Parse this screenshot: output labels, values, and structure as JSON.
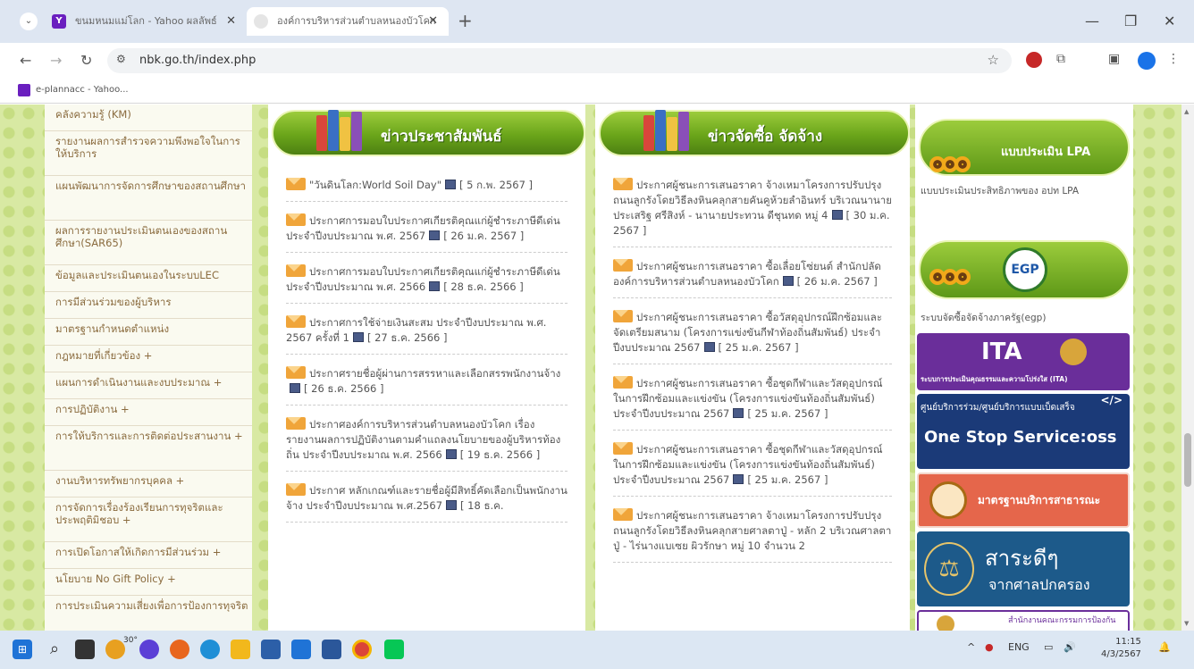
{
  "browser": {
    "tabs": [
      {
        "title": "ขนมหนมแม่โลก - Yahoo ผลลัพธ์",
        "active": false
      },
      {
        "title": "องค์การบริหารส่วนตำบลหนองบัวโคก",
        "active": true
      }
    ],
    "url": "nbk.go.th/index.php",
    "bookmark": "e-plannacc - Yahoo..."
  },
  "left_nav": [
    "คลังความรู้ (KM)",
    "รายงานผลการสำรวจความพึงพอใจในการให้บริการ",
    "แผนพัฒนาการจัดการศึกษาของสถานศึกษา",
    "ผลการรายงานประเมินตนเองของสถานศึกษา(SAR65)",
    "ข้อมูลและประเมินตนเองในระบบLEC",
    "การมีส่วนร่วมของผู้บริหาร",
    "มาตรฐานกำหนดตำแหน่ง",
    "กฎหมายที่เกี่ยวข้อง +",
    "แผนการดำเนินงานและงบประมาณ +",
    "การปฏิบัติงาน +",
    "การให้บริการและการติดต่อประสานงาน +",
    "งานบริหารทรัพยากรบุคคล +",
    "การจัดการเรื่องร้องเรียนการทุจริตและประพฤติมิชอบ +",
    "การเปิดโอกาสให้เกิดการมีส่วนร่วม +",
    "นโยบาย No Gift Policy +",
    "การประเมินความเสี่ยงเพื่อการป้องการทุจริต"
  ],
  "pr_news": {
    "title": "ข่าวประชาสัมพันธ์",
    "items": [
      {
        "text": "\"วันดินโลก:World Soil Day\"",
        "date": "[ 5 ก.พ. 2567 ]"
      },
      {
        "text": "ประกาศการมอบใบประกาศเกียรติคุณแก่ผู้ชำระภาษีดีเด่น ประจำปีงบประมาณ พ.ศ. 2567",
        "date": "[ 26 ม.ค. 2567 ]"
      },
      {
        "text": "ประกาศการมอบใบประกาศเกียรติคุณแก่ผู้ชำระภาษีดีเด่น ประจำปีงบประมาณ พ.ศ. 2566",
        "date": "[ 28 ธ.ค. 2566 ]"
      },
      {
        "text": "ประกาศการใช้จ่ายเงินสะสม ประจำปีงบประมาณ พ.ศ. 2567 ครั้งที่ 1",
        "date": "[ 27 ธ.ค. 2566 ]"
      },
      {
        "text": "ประกาศรายชื่อผู้ผ่านการสรรหาและเลือกสรรพนักงานจ้าง",
        "date": "[ 26 ธ.ค. 2566 ]"
      },
      {
        "text": "ประกาศองค์การบริหารส่วนตำบลหนองบัวโคก เรื่อง รายงานผลการปฏิบัติงานตามคำแถลงนโยบายของผู้บริหารท้องถิ่น ประจำปีงบประมาณ พ.ศ. 2566",
        "date": "[ 19 ธ.ค. 2566 ]"
      },
      {
        "text": "ประกาศ หลักเกณฑ์และรายชื่อผู้มีสิทธิ์คัดเลือกเป็นพนักงานจ้าง ประจำปีงบประมาณ พ.ศ.2567",
        "date": "[ 18 ธ.ค."
      }
    ]
  },
  "procurement_news": {
    "title": "ข่าวจัดซื้อ จัดจ้าง",
    "items": [
      {
        "text": "ประกาศผู้ชนะการเสนอราคา จ้างเหมาโครงการปรับปรุงถนนลูกรังโดยวิธีลงหินคลุกสายคันคูห้วยลำอินทร์ บริเวณนานายประเสริฐ ศรีสิงห์ - นานายประทวน ดีชุนทด หมู่ 4",
        "date": "[ 30 ม.ค. 2567 ]"
      },
      {
        "text": "ประกาศผู้ชนะการเสนอราคา ซื้อเลื่อยโซ่ยนต์ สำนักปลัดองค์การบริหารส่วนตำบลหนองบัวโคก",
        "date": "[ 26 ม.ค. 2567 ]"
      },
      {
        "text": "ประกาศผู้ชนะการเสนอราคา ซื้อวัสดุอุปกรณ์ฝึกซ้อมและจัดเตรียมสนาม (โครงการแข่งขันกีฬาท้องถิ่นสัมพันธ์) ประจำปีงบประมาณ 2567",
        "date": "[ 25 ม.ค. 2567 ]"
      },
      {
        "text": "ประกาศผู้ชนะการเสนอราคา ซื้อชุดกีฬาและวัสดุอุปกรณ์ในการฝึกซ้อมและแข่งขัน (โครงการแข่งขันท้องถิ่นสัมพันธ์) ประจำปีงบประมาณ 2567",
        "date": "[ 25 ม.ค. 2567 ]"
      },
      {
        "text": "ประกาศผู้ชนะการเสนอราคา ซื้อชุดกีฬาและวัสดุอุปกรณ์ในการฝึกซ้อมและแข่งขัน (โครงการแข่งขันท้องถิ่นสัมพันธ์) ประจำปีงบประมาณ 2567",
        "date": "[ 25 ม.ค. 2567 ]"
      },
      {
        "text": "ประกาศผู้ชนะการเสนอราคา จ้างเหมาโครงการปรับปรุงถนนลูกรังโดยวิธีลงหินคลุกสายศาลตาปู่ - หลัก 2 บริเวณศาลตาปู่ - ไร่นางแบเซย ผิวรักษา หมู่ 10 จำนวน 2",
        "date": ""
      }
    ]
  },
  "right_col": {
    "lpa_title": "แบบประเมิน LPA",
    "lpa_desc": "แบบประเมินประสิทธิภาพของ อปท LPA",
    "egp_logo": "EGP",
    "egp_desc": "ระบบจัดซื้อจัดจ้างภาครัฐ(egp)",
    "ita_logo": "ITA",
    "ita_caption": "ระบบการประเมินคุณธรรมและความโปร่งใส (ITA)",
    "oss_top": "ศูนย์บริการร่วม/ศูนย์บริการแบบเบ็ดเสร็จ",
    "oss_main": "One Stop Service:oss",
    "oss_code": "</>",
    "std_title": "มาตรฐานบริการสาธารณะ",
    "court_main": "สาระดีๆ",
    "court_sub": "จากศาลปกครอง",
    "bottom_label": "สำนักงานคณะกรรมการป้องกัน"
  },
  "taskbar": {
    "weather": "30°",
    "lang": "ENG",
    "time": "11:15",
    "date": "4/3/2567"
  }
}
